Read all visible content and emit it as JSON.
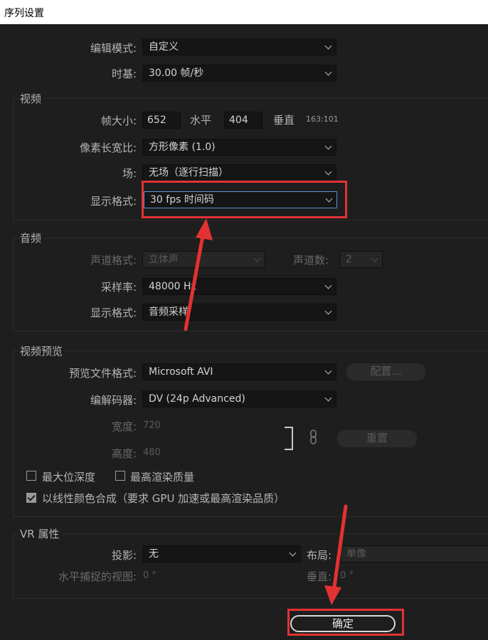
{
  "window": {
    "title": "序列设置"
  },
  "general": {
    "edit_mode_label": "编辑模式:",
    "edit_mode_value": "自定义",
    "timebase_label": "时基:",
    "timebase_value": "30.00  帧/秒"
  },
  "video": {
    "section_title": "视频",
    "frame_size_label": "帧大小:",
    "frame_width": "652",
    "horizontal_label": "水平",
    "frame_height": "404",
    "vertical_label": "垂直",
    "aspect_ratio": "163:101",
    "pixel_aspect_label": "像素长宽比:",
    "pixel_aspect_value": "方形像素 (1.0)",
    "fields_label": "场:",
    "fields_value": "无场（逐行扫描）",
    "display_format_label": "显示格式:",
    "display_format_value": "30 fps 时间码"
  },
  "audio": {
    "section_title": "音频",
    "channel_format_label": "声道格式:",
    "channel_format_value": "立体声",
    "channel_count_label": "声道数:",
    "channel_count_value": "2",
    "sample_rate_label": "采样率:",
    "sample_rate_value": "48000 Hz",
    "display_format_label": "显示格式:",
    "display_format_value": "音频采样"
  },
  "video_preview": {
    "section_title": "视频预览",
    "file_format_label": "预览文件格式:",
    "file_format_value": "Microsoft AVI",
    "configure_label": "配置...",
    "codec_label": "编解码器:",
    "codec_value": "DV (24p Advanced)",
    "width_label": "宽度:",
    "width_value": "720",
    "height_label": "高度:",
    "height_value": "480",
    "reset_label": "重置",
    "max_bit_depth_label": "最大位深度",
    "max_render_quality_label": "最高渲染质量",
    "linear_color_label": "以线性颜色合成（要求 GPU 加速或最高渲染品质）",
    "max_bit_depth_checked": false,
    "max_render_quality_checked": false,
    "linear_color_checked": true
  },
  "vr": {
    "section_title": "VR 属性",
    "projection_label": "投影:",
    "projection_value": "无",
    "layout_label": "布局:",
    "layout_value": "单像",
    "h_view_label": "水平捕捉的视图:",
    "h_view_value": "0 °",
    "v_label": "垂直:",
    "v_value": "0 °"
  },
  "footer": {
    "ok_label": "确定"
  },
  "colors": {
    "highlight": "#e23232",
    "background": "#1e1e1e"
  }
}
